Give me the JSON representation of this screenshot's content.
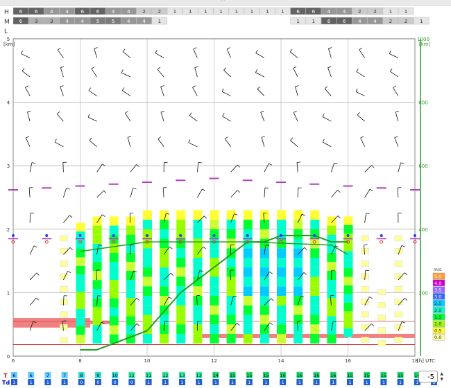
{
  "collapse_icon": "chevron-up-icon",
  "cloud_rows": [
    {
      "label": "H",
      "cells": [
        "6",
        "6",
        "4",
        "4",
        "6",
        "6",
        "4",
        "4",
        "2",
        "2",
        "1",
        "1",
        "1",
        "1",
        "1",
        "1",
        "1",
        "1",
        "6",
        "6",
        "4",
        "4",
        "2",
        "2",
        "1",
        "1"
      ]
    },
    {
      "label": "M",
      "cells": [
        "6",
        "3",
        "3",
        "4",
        "4",
        "5",
        "5",
        "4",
        "4",
        "1",
        "",
        "",
        "",
        "",
        "",
        "",
        "",
        "",
        "1",
        "1",
        "6",
        "6",
        "4",
        "4",
        "2",
        "2",
        "1"
      ]
    },
    {
      "label": "L",
      "cells": []
    }
  ],
  "axes": {
    "y_left_unit": "[km]",
    "y_left_ticks": [
      "5",
      "4",
      "3",
      "2",
      "1",
      "0"
    ],
    "y_right_unit": "[km]",
    "y_right_ticks": [
      "1000",
      "800",
      "600",
      "400",
      "200"
    ],
    "x_ticks": [
      "6",
      "8",
      "10",
      "12",
      "14",
      "16",
      "18"
    ],
    "x_unit": "[h] UTC"
  },
  "legend": {
    "unit": "m/s",
    "entries": [
      {
        "label": "5.0",
        "color": "#ff9933"
      },
      {
        "label": "4.0",
        "color": "#cc00cc"
      },
      {
        "label": "3.5",
        "color": "#9966ff"
      },
      {
        "label": "3.0",
        "color": "#3366ff"
      },
      {
        "label": "2.5",
        "color": "#00ccff"
      },
      {
        "label": "2.0",
        "color": "#00ffcc"
      },
      {
        "label": "1.5",
        "color": "#00ff33"
      },
      {
        "label": "1.0",
        "color": "#99ff00"
      },
      {
        "label": "0.5",
        "color": "#ffff33"
      },
      {
        "label": "0.0",
        "color": "#ffffaa"
      }
    ]
  },
  "temps": {
    "t_label": "T",
    "td_label": "Td",
    "t": [
      "6",
      "6",
      "7",
      "7",
      "8",
      "9",
      "10",
      "11",
      "11",
      "12",
      "13",
      "13",
      "14",
      "15",
      "15",
      "15",
      "16",
      "16",
      "16",
      "16",
      "15",
      "15",
      "15",
      "15",
      "14",
      "13"
    ],
    "td": [
      "1",
      "1",
      "1",
      "1",
      "0",
      "0",
      "0",
      "0",
      "1",
      "1",
      "1",
      "1",
      "1",
      "1",
      "1",
      "1",
      "1",
      "1",
      "1",
      "1",
      "1",
      "1",
      "1",
      "1",
      "1",
      "1"
    ]
  },
  "spinner": {
    "value": "-5"
  },
  "chart_data": {
    "type": "bar",
    "x": [
      8,
      8.5,
      9,
      9.5,
      10,
      10.5,
      11,
      11.5,
      12,
      12.5,
      13,
      13.5,
      14,
      14.5,
      15,
      15.5,
      16
    ],
    "cloud_tops_km": [
      2.1,
      2.2,
      2.2,
      2.2,
      2.3,
      2.3,
      2.3,
      2.3,
      2.3,
      2.3,
      2.3,
      2.3,
      2.3,
      2.3,
      2.3,
      2.2,
      2.2
    ],
    "cloud_base_km": [
      0.2,
      0.2,
      0.2,
      0.2,
      0.2,
      0.2,
      0.2,
      0.2,
      0.2,
      0.2,
      0.2,
      0.2,
      0.2,
      0.2,
      0.2,
      0.2,
      0.3
    ],
    "boundary_layer_height_km": [
      0.1,
      0.1,
      0.2,
      0.3,
      0.4,
      0.7,
      1.0,
      1.2,
      1.4,
      1.6,
      1.8,
      1.8,
      1.9,
      1.9,
      1.9,
      1.8,
      1.8
    ],
    "ylabel": "[km]",
    "xlabel": "[h] UTC",
    "x_range": [
      6,
      18
    ],
    "y_range": [
      0,
      5
    ]
  }
}
